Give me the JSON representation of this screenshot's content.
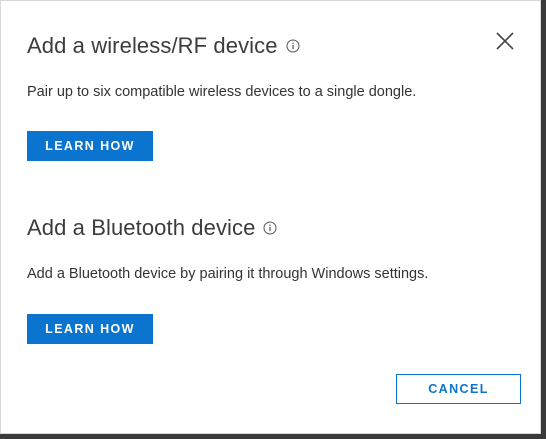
{
  "dialog": {
    "close_icon": "close-icon",
    "info_icon": "info-icon",
    "accent_color": "#0a74cf",
    "sections": [
      {
        "title": "Add a wireless/RF device",
        "description": "Pair up to six compatible wireless devices to a single dongle.",
        "button_label": "LEARN HOW"
      },
      {
        "title": "Add a Bluetooth device",
        "description": "Add a Bluetooth device by pairing it through Windows settings.",
        "button_label": "LEARN HOW"
      }
    ],
    "cancel_label": "CANCEL"
  }
}
